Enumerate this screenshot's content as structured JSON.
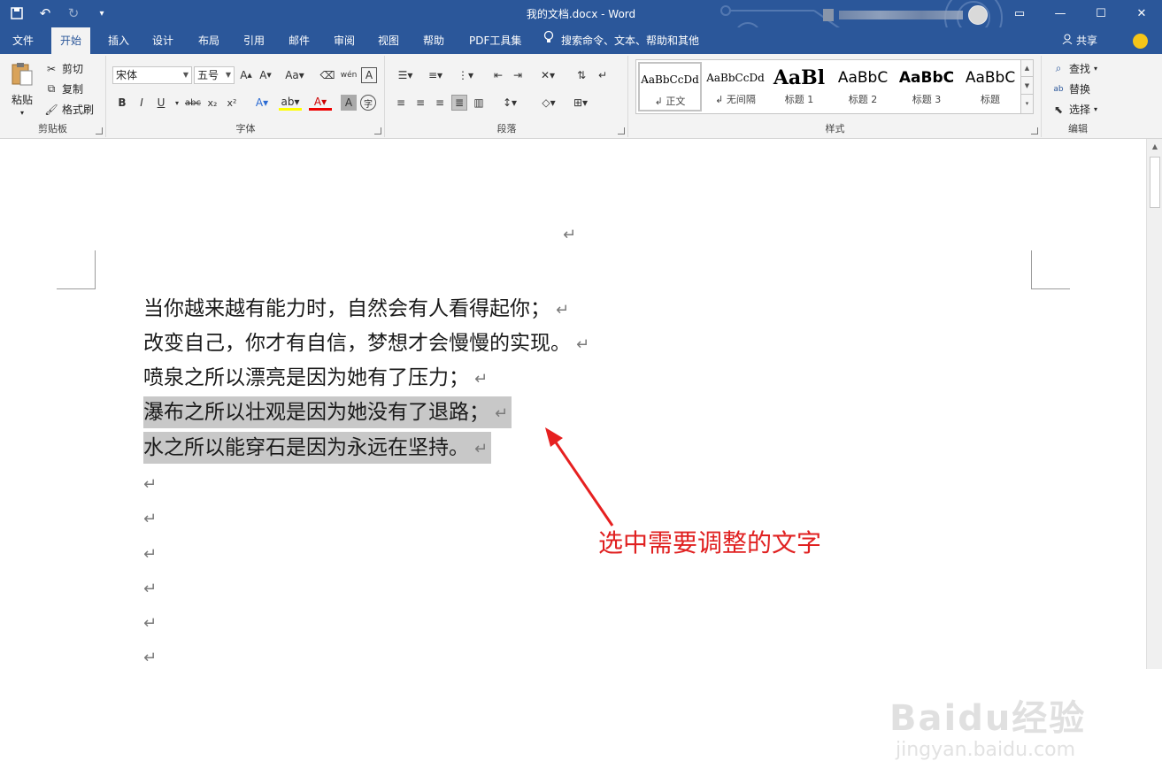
{
  "window": {
    "title": "我的文档.docx  -  Word"
  },
  "qat": {
    "save": "save-icon",
    "undo": "undo-icon",
    "redo": "redo-icon",
    "customize": "▾"
  },
  "tabs": [
    "文件",
    "开始",
    "插入",
    "设计",
    "布局",
    "引用",
    "邮件",
    "审阅",
    "视图",
    "帮助",
    "PDF工具集"
  ],
  "tellme": "搜索命令、文本、帮助和其他",
  "share": "共享",
  "clipboard": {
    "paste": "粘贴",
    "cut": "剪切",
    "copy": "复制",
    "painter": "格式刷",
    "label": "剪贴板"
  },
  "font": {
    "name": "宋体",
    "size": "五号",
    "label": "字体"
  },
  "paragraph": {
    "label": "段落"
  },
  "styles": {
    "label": "样式",
    "items": [
      {
        "sample": "AaBbCcDd",
        "name": "正文"
      },
      {
        "sample": "AaBbCcDd",
        "name": "无间隔"
      },
      {
        "sample": "AaBl",
        "name": "标题 1"
      },
      {
        "sample": "AaBbC",
        "name": "标题 2"
      },
      {
        "sample": "AaBbC",
        "name": "标题 3"
      },
      {
        "sample": "AaBbC",
        "name": "标题"
      }
    ]
  },
  "editing": {
    "find": "查找",
    "replace": "替换",
    "select": "选择",
    "label": "编辑"
  },
  "document": {
    "lines": [
      "当你越来越有能力时，自然会有人看得起你；",
      "改变自己，你才有自信，梦想才会慢慢的实现。",
      "喷泉之所以漂亮是因为她有了压力；",
      "瀑布之所以壮观是因为她没有了退路；",
      "水之所以能穿石是因为永远在坚持。"
    ],
    "paragraph_mark": "↵"
  },
  "annotation": "选中需要调整的文字",
  "watermark": {
    "brand": "Baidu经验",
    "url": "jingyan.baidu.com"
  }
}
